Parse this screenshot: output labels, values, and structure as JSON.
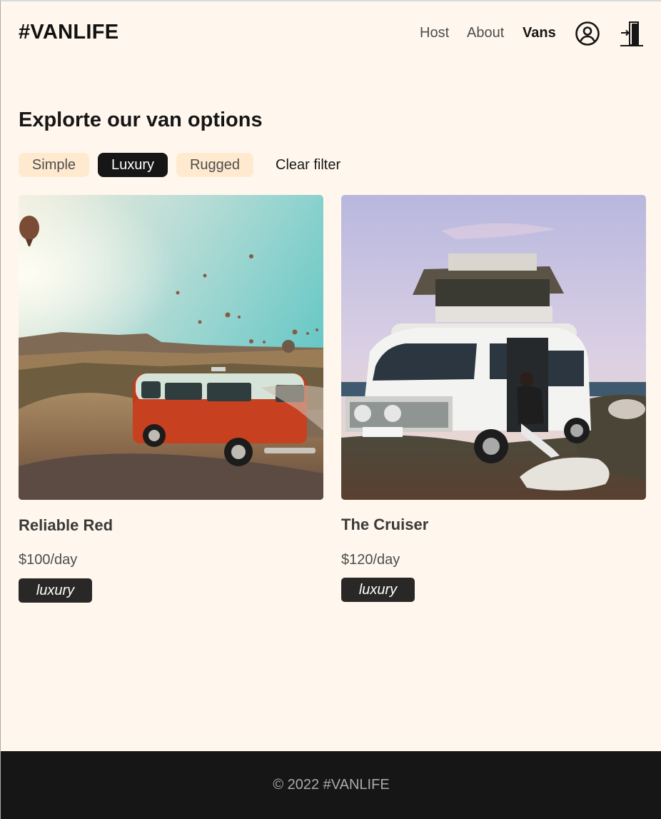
{
  "header": {
    "logo": "#VANLIFE",
    "nav": {
      "host": "Host",
      "about": "About",
      "vans": "Vans"
    },
    "icons": [
      "user-circle-icon",
      "logout-door-icon"
    ]
  },
  "main": {
    "title": "Explorte our van options",
    "filters": {
      "simple": "Simple",
      "luxury": "Luxury",
      "rugged": "Rugged",
      "clear": "Clear filter",
      "active": "Luxury"
    },
    "vans": [
      {
        "name": "Reliable Red",
        "price": "$100/day",
        "type": "luxury"
      },
      {
        "name": "The Cruiser",
        "price": "$120/day",
        "type": "luxury"
      }
    ]
  },
  "footer": {
    "text": "© 2022 #VANLIFE"
  },
  "colors": {
    "background": "#fff7ed",
    "chip": "#ffead0",
    "dark": "#161616",
    "luxury_badge": "#2a2827"
  }
}
